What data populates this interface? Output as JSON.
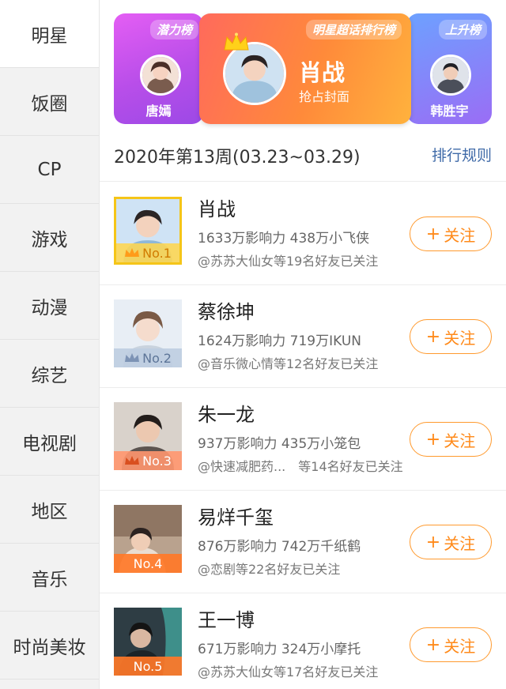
{
  "sidebar": {
    "items": [
      {
        "label": "明星"
      },
      {
        "label": "饭圈"
      },
      {
        "label": "CP"
      },
      {
        "label": "游戏"
      },
      {
        "label": "动漫"
      },
      {
        "label": "综艺"
      },
      {
        "label": "电视剧"
      },
      {
        "label": "地区"
      },
      {
        "label": "音乐"
      },
      {
        "label": "时尚美妆"
      }
    ]
  },
  "banner": {
    "left": {
      "tag": "潜力榜",
      "name": "唐嫣"
    },
    "center": {
      "tag": "明星超话排行榜",
      "name": "肖战",
      "subtitle": "抢占封面"
    },
    "right": {
      "tag": "上升榜",
      "name": "韩胜宇"
    }
  },
  "week": {
    "label": "2020年第13周(03.23~03.29)",
    "rule_link": "排行规则"
  },
  "follow_label": "关注",
  "follow_plus": "+",
  "ranking": [
    {
      "rank": "No.1",
      "name": "肖战",
      "stats": "1633万影响力 438万小飞侠",
      "friends": "@苏苏大仙女等19名好友已关注"
    },
    {
      "rank": "No.2",
      "name": "蔡徐坤",
      "stats": "1624万影响力 719万IKUN",
      "friends": "@音乐微心情等12名好友已关注"
    },
    {
      "rank": "No.3",
      "name": "朱一龙",
      "stats": "937万影响力 435万小笼包",
      "friends": "@快速减肥药...　等14名好友已关注"
    },
    {
      "rank": "No.4",
      "name": "易烊千玺",
      "stats": "876万影响力 742万千纸鹤",
      "friends": "@恋剧等22名好友已关注"
    },
    {
      "rank": "No.5",
      "name": "王一博",
      "stats": "671万影响力 324万小摩托",
      "friends": "@苏苏大仙女等17名好友已关注"
    }
  ],
  "colors": {
    "accent_orange": "#ff8a1a",
    "link_blue": "#3f6aa8",
    "gold": "#f5c518"
  }
}
